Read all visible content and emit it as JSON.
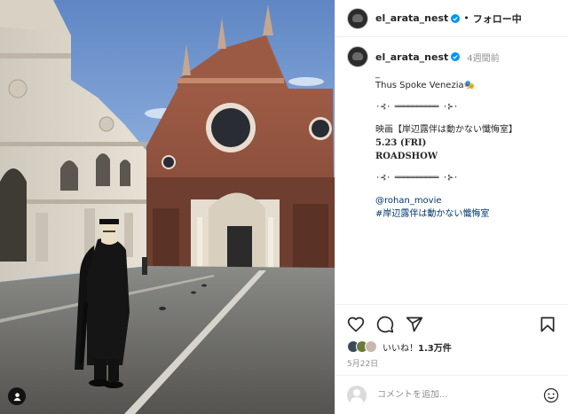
{
  "post": {
    "username": "el_arata_nest",
    "follow_label": "フォロー中",
    "dot": "•",
    "time_ago": "4週間前",
    "caption_lines": {
      "l1": "_",
      "l2": "Thus Spoke Venezia🎭",
      "l3": "·⊰· ══════════ ·⊱·",
      "l4": "映画【岸辺露伴は動かない懺悔室】",
      "l5": "5.23 (FRI)",
      "l6": "ROADSHOW",
      "l7": "·⊰· ══════════ ·⊱·",
      "l8": "@rohan_movie",
      "l9": "#岸辺露伴は動かない懺悔室"
    },
    "likes_prefix": "いいね！",
    "likes_count": "1.3万件",
    "date": "5月22日",
    "comment_placeholder": "コメントを追加..."
  },
  "icons": {
    "like": "heart-icon",
    "comment": "comment-icon",
    "share": "share-icon",
    "save": "bookmark-icon",
    "emoji": "emoji-icon",
    "verified": "verified-badge-icon",
    "user_tag": "user-tag-icon"
  },
  "colors": {
    "verified": "#0095f6",
    "link": "#00376b",
    "secondary_text": "#8e8e8e",
    "divider": "#efefef"
  }
}
